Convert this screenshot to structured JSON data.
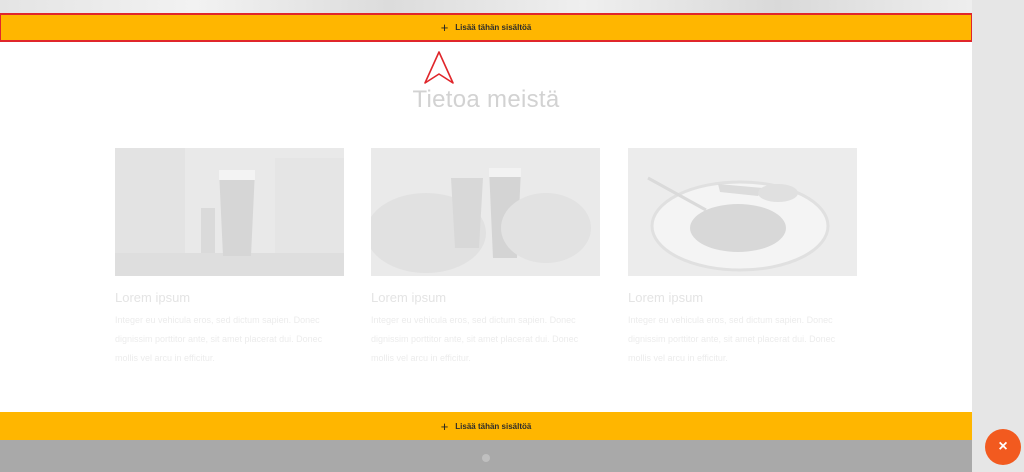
{
  "add_section_top": {
    "icon": "plus-icon",
    "label": "Lisää tähän sisältöä"
  },
  "add_section_bottom": {
    "icon": "plus-icon",
    "label": "Lisää tähän sisältöä"
  },
  "section": {
    "title": "Tietoa meistä"
  },
  "cards": [
    {
      "heading": "Lorem ipsum",
      "body": "Integer eu vehicula eros, sed dictum sapien. Donec dignissim porttitor ante, sit amet placerat dui. Donec mollis vel arcu in efficitur.",
      "image": "beer-glass-photo"
    },
    {
      "heading": "Lorem ipsum",
      "body": "Integer eu vehicula eros, sed dictum sapien. Donec dignissim porttitor ante, sit amet placerat dui. Donec mollis vel arcu in efficitur.",
      "image": "toast-glasses-photo"
    },
    {
      "heading": "Lorem ipsum",
      "body": "Integer eu vehicula eros, sed dictum sapien. Donec dignissim porttitor ante, sit amet placerat dui. Donec mollis vel arcu in efficitur.",
      "image": "food-plate-photo"
    }
  ],
  "close_button": {
    "icon": "close-icon",
    "symbol": "×"
  },
  "colors": {
    "accent": "#ffb600",
    "highlight_outline": "#e0262b",
    "fab": "#f25a1f",
    "footer": "#a9a9a9"
  }
}
